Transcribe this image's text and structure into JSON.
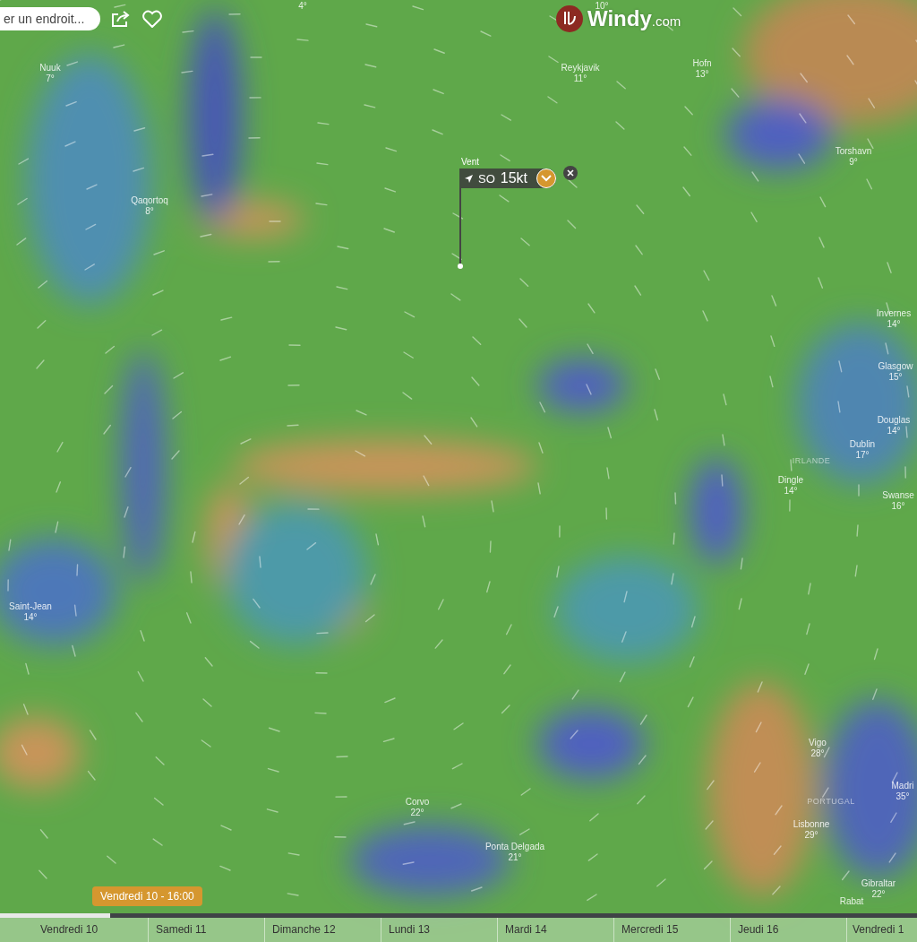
{
  "search": {
    "placeholder": "er un endroit..."
  },
  "logo": {
    "name": "Windy",
    "suffix": ".com"
  },
  "places": [
    {
      "kind": "city",
      "temp": "4°"
    },
    {
      "kind": "city",
      "name": "Nuuk",
      "temp": "7°"
    },
    {
      "kind": "city",
      "temp": "10°"
    },
    {
      "kind": "city",
      "name": "Reykjavik",
      "temp": "11°"
    },
    {
      "kind": "city",
      "name": "Hofn",
      "temp": "13°"
    },
    {
      "kind": "city",
      "name": "Qaqortoq",
      "temp": "8°"
    },
    {
      "kind": "city",
      "name": "Torshavn",
      "temp": "9°"
    },
    {
      "kind": "city",
      "name": "Invernes",
      "temp": "14°"
    },
    {
      "kind": "city",
      "name": "Glasgow",
      "temp": "15°"
    },
    {
      "kind": "city",
      "name": "Douglas",
      "temp": "14°"
    },
    {
      "kind": "city",
      "name": "Dublin",
      "temp": "17°"
    },
    {
      "kind": "country",
      "name": "IRLANDE"
    },
    {
      "kind": "city",
      "name": "Dingle",
      "temp": "14°"
    },
    {
      "kind": "city",
      "name": "Swanse",
      "temp": "16°"
    },
    {
      "kind": "city",
      "name": "Saint-Jean",
      "temp": "14°"
    },
    {
      "kind": "city",
      "name": "Vigo",
      "temp": "28°"
    },
    {
      "kind": "city",
      "name": "Madri",
      "temp": "35°"
    },
    {
      "kind": "country",
      "name": "PORTUGAL"
    },
    {
      "kind": "city",
      "name": "Corvo",
      "temp": "22°"
    },
    {
      "kind": "city",
      "name": "Lisbonne",
      "temp": "29°"
    },
    {
      "kind": "city",
      "name": "Ponta Delgada",
      "temp": "21°"
    },
    {
      "kind": "city",
      "name": "Gibraltar",
      "temp": "22°"
    },
    {
      "kind": "city",
      "name": "Rabat"
    }
  ],
  "wind_popup": {
    "title": "Vent",
    "direction": "SO",
    "speed": "15kt"
  },
  "timeline": {
    "current": "Vendredi 10 - 16:00",
    "level": 0.12,
    "days": [
      "Vendredi 10",
      "Samedi 11",
      "Dimanche 12",
      "Lundi 13",
      "Mardi 14",
      "Mercredi 15",
      "Jeudi 16",
      "Vendredi 1"
    ]
  }
}
